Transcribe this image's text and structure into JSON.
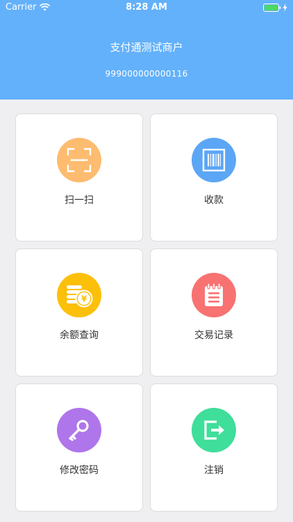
{
  "status_bar": {
    "carrier": "Carrier",
    "time": "8:28 AM"
  },
  "merchant": {
    "name": "支付通测试商户",
    "id": "999000000000116"
  },
  "colors": {
    "header": "#63b1fa",
    "scan": "#fdbc6f",
    "receive": "#5ba6f5",
    "balance": "#fcc00a",
    "records": "#f87272",
    "password": "#af75ea",
    "logout": "#3fde9a"
  },
  "menu": [
    {
      "label": "扫一扫",
      "icon": "scan-icon"
    },
    {
      "label": "收款",
      "icon": "barcode-icon"
    },
    {
      "label": "余额查询",
      "icon": "coins-icon"
    },
    {
      "label": "交易记录",
      "icon": "notepad-icon"
    },
    {
      "label": "修改密码",
      "icon": "key-icon"
    },
    {
      "label": "注销",
      "icon": "logout-icon"
    }
  ]
}
